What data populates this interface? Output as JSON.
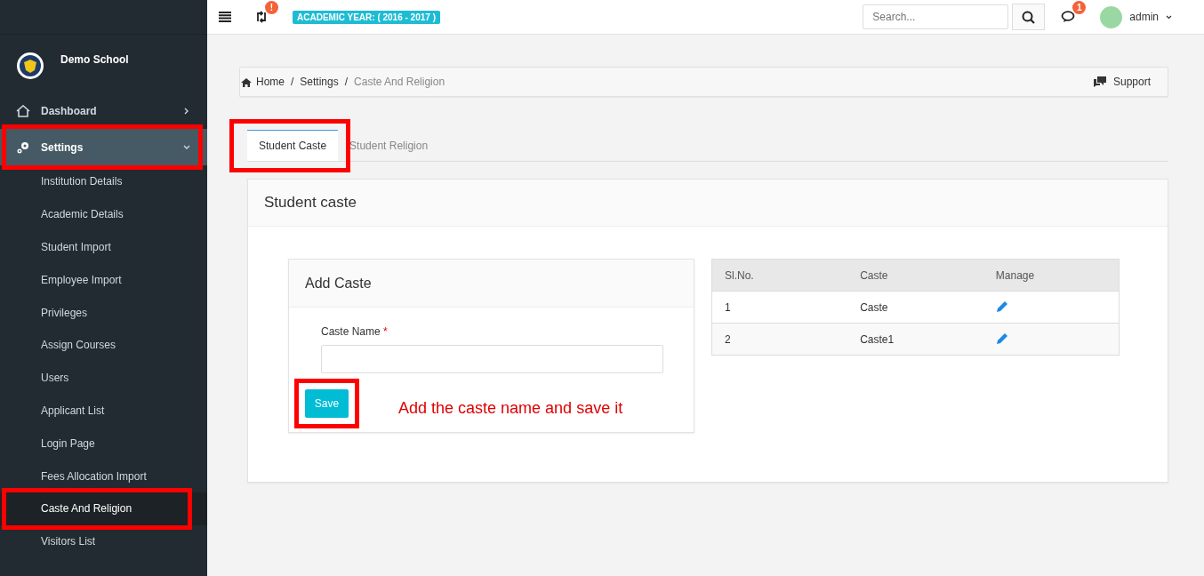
{
  "sidebar": {
    "school_name": "Demo School",
    "items": [
      {
        "label": "Dashboard",
        "expanded": false,
        "highlighted": false,
        "selected": false
      },
      {
        "label": "Settings",
        "expanded": true,
        "highlighted": true,
        "selected": true,
        "children": [
          {
            "label": "Institution Details",
            "selected": false,
            "highlighted": false
          },
          {
            "label": "Academic Details",
            "selected": false,
            "highlighted": false
          },
          {
            "label": "Student Import",
            "selected": false,
            "highlighted": false
          },
          {
            "label": "Employee Import",
            "selected": false,
            "highlighted": false
          },
          {
            "label": "Privileges",
            "selected": false,
            "highlighted": false
          },
          {
            "label": "Assign Courses",
            "selected": false,
            "highlighted": false
          },
          {
            "label": "Users",
            "selected": false,
            "highlighted": false
          },
          {
            "label": "Applicant List",
            "selected": false,
            "highlighted": false
          },
          {
            "label": "Login Page",
            "selected": false,
            "highlighted": false
          },
          {
            "label": "Fees Allocation Import",
            "selected": false,
            "highlighted": false
          },
          {
            "label": "Caste And Religion",
            "selected": true,
            "highlighted": true
          },
          {
            "label": "Visitors List",
            "selected": false,
            "highlighted": false
          }
        ]
      }
    ]
  },
  "topbar": {
    "sync_badge": "!",
    "academic_year": "ACADEMIC YEAR: ( 2016 - 2017 )",
    "search": {
      "placeholder": "Search..."
    },
    "chat_badge": "1",
    "user": "admin"
  },
  "breadcrumb": {
    "items": [
      "Home",
      "Settings",
      "Caste And Religion"
    ],
    "separator": "/",
    "support": "Support"
  },
  "tabs": [
    {
      "label": "Student Caste",
      "selected": true,
      "highlighted": true
    },
    {
      "label": "Student Religion",
      "selected": false,
      "highlighted": false
    }
  ],
  "panel": {
    "title": "Student caste",
    "form": {
      "title": "Add Caste",
      "field_label": "Caste Name",
      "required_mark": "*",
      "save": "Save",
      "save_highlighted": true,
      "annotation": "Add the caste name and save it"
    },
    "table": {
      "columns": [
        "Sl.No.",
        "Caste",
        "Manage"
      ],
      "rows": [
        {
          "sl_no": "1",
          "caste": "Caste"
        },
        {
          "sl_no": "2",
          "caste": "Caste1"
        }
      ]
    }
  }
}
